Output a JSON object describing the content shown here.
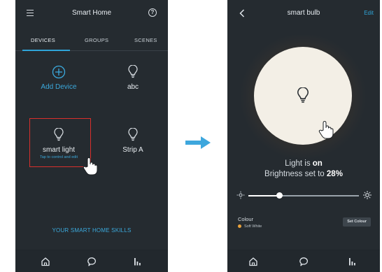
{
  "left_screen": {
    "title": "Smart Home",
    "tabs": [
      {
        "label": "DEVICES",
        "active": true
      },
      {
        "label": "GROUPS",
        "active": false
      },
      {
        "label": "SCENES",
        "active": false
      }
    ],
    "devices": [
      {
        "label": "Add Device",
        "icon": "plus-circle-icon"
      },
      {
        "label": "abc",
        "icon": "lightbulb-icon"
      },
      {
        "label": "smart light",
        "icon": "lightbulb-icon",
        "hint": "Tap to control and edit"
      },
      {
        "label": "Strip A",
        "icon": "lightbulb-icon"
      }
    ],
    "skills_link": "YOUR SMART HOME SKILLS",
    "nav_icons": [
      "home-icon",
      "chat-icon",
      "bars-icon"
    ]
  },
  "right_screen": {
    "title": "smart bulb",
    "edit_label": "Edit",
    "status_prefix": "Light is ",
    "status_value": "on",
    "brightness_prefix": "Brightness set to ",
    "brightness_value": "28%",
    "brightness_fraction": 0.28,
    "colour_label": "Colour",
    "colour_value": "Soft White",
    "set_colour_label": "Set Colour",
    "nav_icons": [
      "home-icon",
      "chat-icon",
      "bars-icon"
    ]
  },
  "colors": {
    "background": "#252b30",
    "accent": "#2fa4d8",
    "highlight": "#d9302c",
    "colour_dot": "#e9a23b"
  }
}
